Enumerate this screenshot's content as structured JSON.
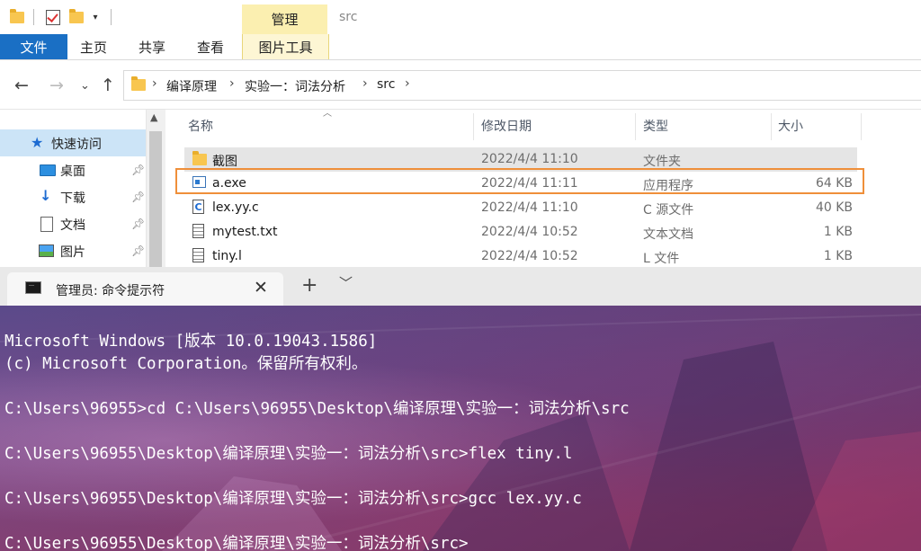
{
  "explorer": {
    "title": "src",
    "context_tab": "管理",
    "ribbon_tabs": [
      "文件",
      "主页",
      "共享",
      "查看",
      "图片工具"
    ],
    "breadcrumb": [
      "编译原理",
      "实验一：词法分析",
      "src"
    ],
    "sidebar": {
      "quick_access": "快速访问",
      "items": [
        {
          "label": "桌面",
          "icon": "desktop-icon"
        },
        {
          "label": "下载",
          "icon": "download-icon"
        },
        {
          "label": "文档",
          "icon": "document-icon"
        },
        {
          "label": "图片",
          "icon": "pictures-icon"
        }
      ]
    },
    "columns": {
      "name": "名称",
      "date": "修改日期",
      "type": "类型",
      "size": "大小"
    },
    "files": [
      {
        "name": "截图",
        "date": "2022/4/4 11:10",
        "type": "文件夹",
        "size": "",
        "icon": "folder-icon"
      },
      {
        "name": "a.exe",
        "date": "2022/4/4 11:11",
        "type": "应用程序",
        "size": "64 KB",
        "icon": "exe-icon"
      },
      {
        "name": "lex.yy.c",
        "date": "2022/4/4 11:10",
        "type": "C 源文件",
        "size": "40 KB",
        "icon": "c-file-icon"
      },
      {
        "name": "mytest.txt",
        "date": "2022/4/4 10:52",
        "type": "文本文档",
        "size": "1 KB",
        "icon": "text-file-icon"
      },
      {
        "name": "tiny.l",
        "date": "2022/4/4 10:52",
        "type": "L 文件",
        "size": "1 KB",
        "icon": "text-file-icon"
      }
    ],
    "highlight_color": "#ef8f3a",
    "accent": "#1a6fc4"
  },
  "terminal": {
    "tab_title": "管理员: 命令提示符",
    "lines": [
      "Microsoft Windows [版本 10.0.19043.1586]",
      "(c) Microsoft Corporation。保留所有权利。",
      "",
      "C:\\Users\\96955>cd C:\\Users\\96955\\Desktop\\编译原理\\实验一：词法分析\\src",
      "",
      "C:\\Users\\96955\\Desktop\\编译原理\\实验一：词法分析\\src>flex tiny.l",
      "",
      "C:\\Users\\96955\\Desktop\\编译原理\\实验一：词法分析\\src>gcc lex.yy.c",
      "",
      "C:\\Users\\96955\\Desktop\\编译原理\\实验一：词法分析\\src>"
    ]
  }
}
